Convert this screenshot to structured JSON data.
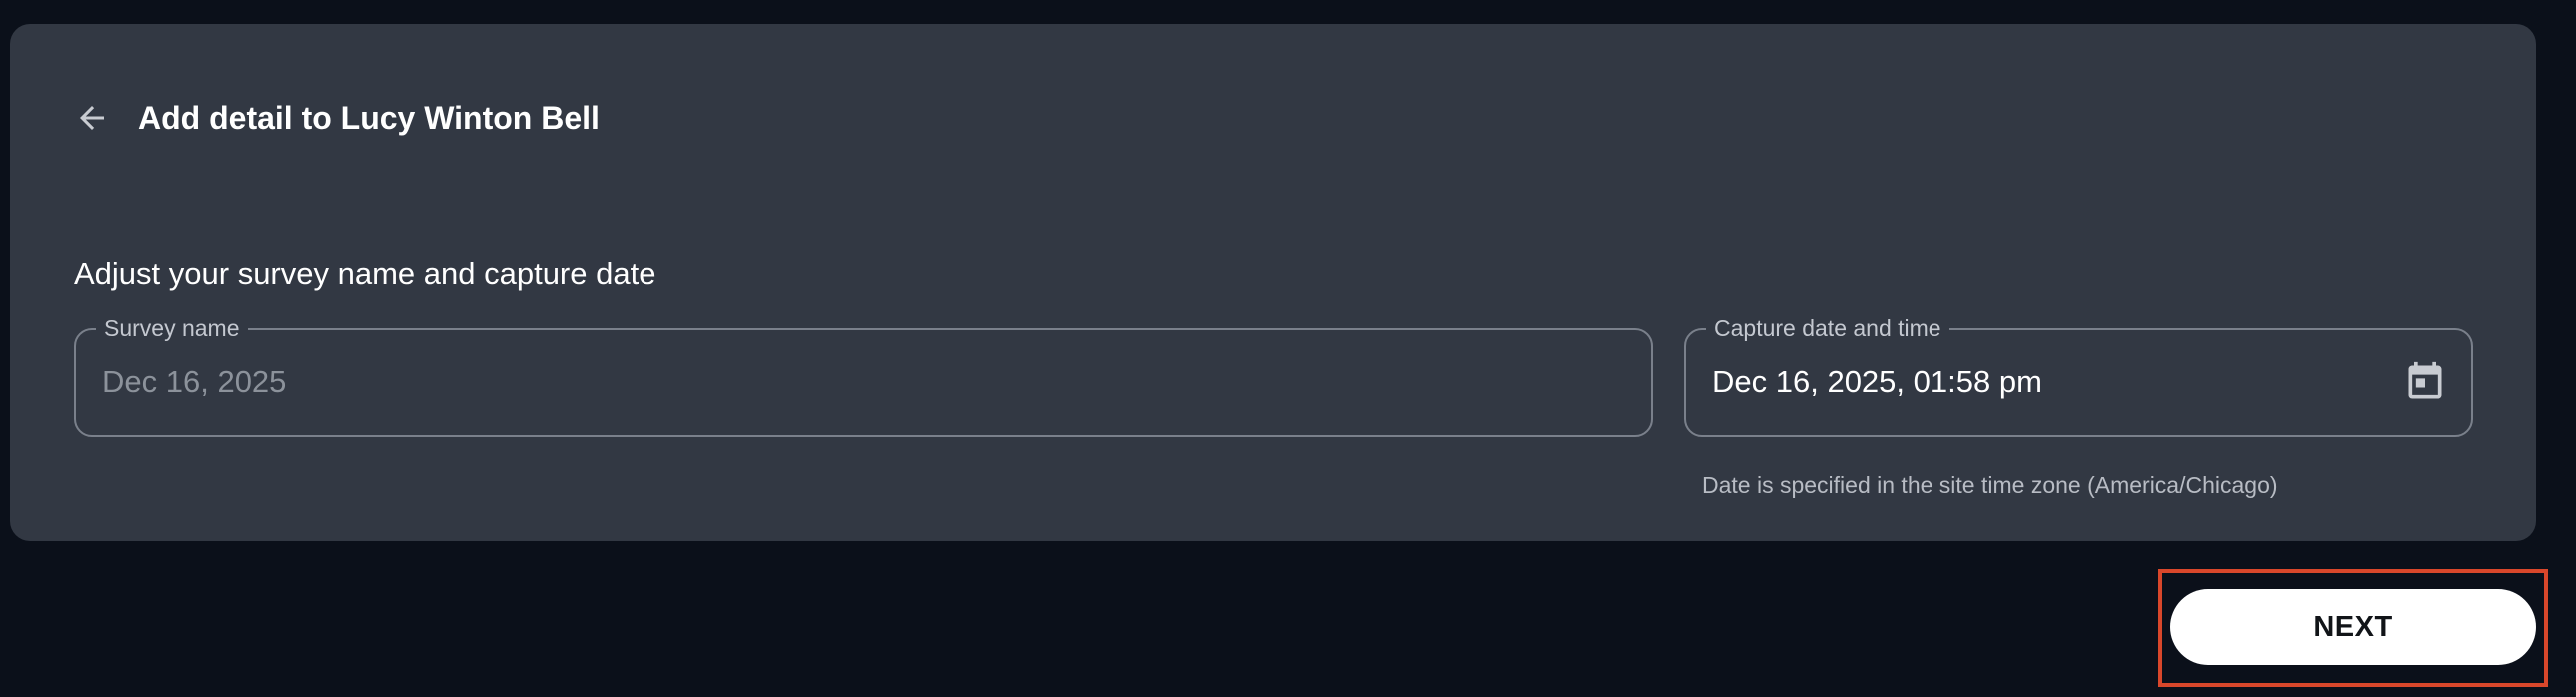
{
  "header": {
    "title": "Add detail to Lucy Winton Bell",
    "back_icon": "arrow-left-icon"
  },
  "form": {
    "section_title": "Adjust your survey name and capture date",
    "survey_name": {
      "label": "Survey name",
      "placeholder": "Dec 16, 2025"
    },
    "capture_date": {
      "label": "Capture date and time",
      "value": "Dec 16, 2025, 01:58 pm",
      "icon": "calendar-icon",
      "helper_text": "Date is specified in the site time zone (America/Chicago)"
    }
  },
  "actions": {
    "next_label": "NEXT"
  },
  "colors": {
    "background": "#0b101a",
    "card": "#323843",
    "field_border": "#7a808b",
    "highlight": "#d9472b",
    "button_bg": "#ffffff"
  }
}
